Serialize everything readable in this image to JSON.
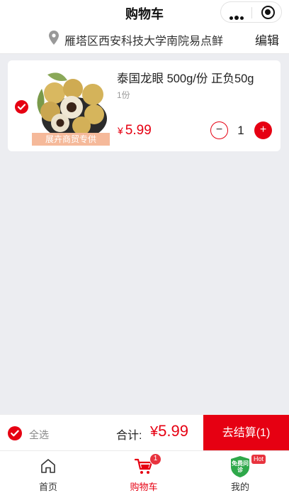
{
  "header": {
    "title": "购物车"
  },
  "address": {
    "text": "雁塔区西安科技大学南院易点鲜",
    "edit_label": "编辑"
  },
  "cart_item": {
    "title": "泰国龙眼 500g/份 正负50g",
    "spec": "1份",
    "price_currency": "¥",
    "price": "5.99",
    "quantity": "1",
    "minus_label": "−",
    "plus_label": "+",
    "image_banner": "展卉商贸专供"
  },
  "checkout": {
    "select_all_label": "全选",
    "total_label": "合计:",
    "total_currency": "¥",
    "total_amount": "5.99",
    "settle_label": "去结算(1)"
  },
  "tabbar": {
    "home_label": "首页",
    "cart_label": "购物车",
    "cart_badge": "1",
    "me_label": "我的",
    "me_hot_badge": "Hot",
    "me_icon_text": "免费问诊"
  },
  "colors": {
    "accent": "#e60012",
    "background": "#ecedf1"
  }
}
